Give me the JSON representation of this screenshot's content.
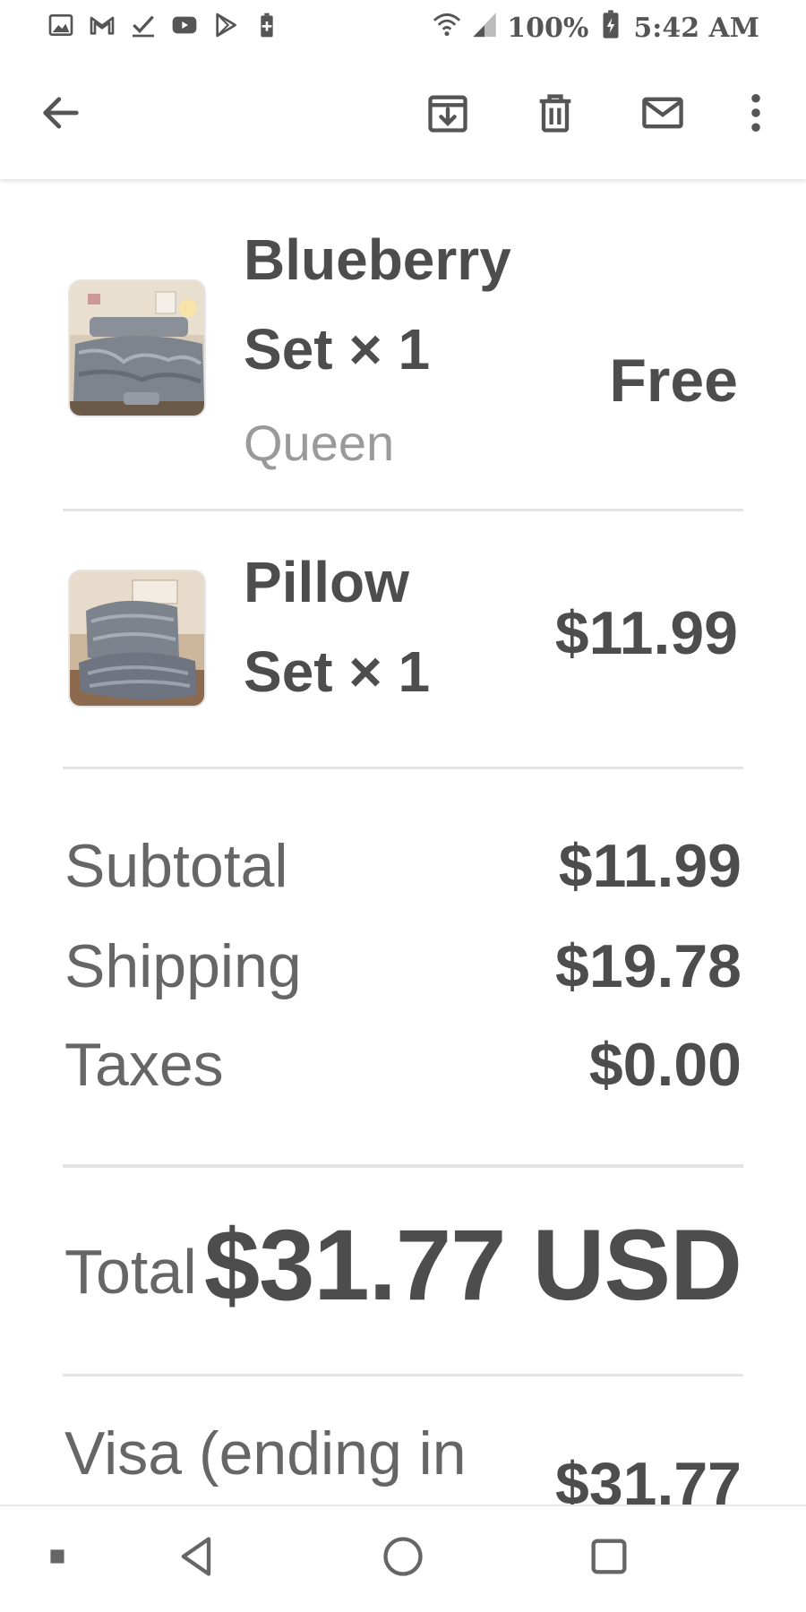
{
  "status_bar": {
    "left_icons": [
      "gallery-icon",
      "gmail-icon",
      "tasks-check-icon",
      "youtube-icon",
      "play-store-icon",
      "battery-saver-icon"
    ],
    "battery": "100%",
    "time": "5:42 AM"
  },
  "app_bar": {
    "icons": [
      "back-arrow-icon",
      "archive-icon",
      "delete-icon",
      "mark-unread-icon",
      "more-options-icon"
    ]
  },
  "order": {
    "items": [
      {
        "title_line1": "Blueberry",
        "title_line2": "Set × 1",
        "variant": "Queen",
        "price": "Free",
        "thumbnail": "bedding-set-thumbnail"
      },
      {
        "title_line1": "Pillow",
        "title_line2": "Set × 1",
        "variant": "",
        "price": "$11.99",
        "thumbnail": "pillow-set-thumbnail"
      }
    ],
    "summary": [
      {
        "label": "Subtotal",
        "value": "$11.99"
      },
      {
        "label": "Shipping",
        "value": "$19.78"
      },
      {
        "label": "Taxes",
        "value": "$0.00"
      }
    ],
    "total": {
      "label": "Total",
      "value": "$31.77 USD"
    },
    "payment": {
      "label": "Visa (ending in",
      "value": "$31.77"
    }
  },
  "nav_bar": {
    "icons": [
      "recent-dot-icon",
      "back-triangle-icon",
      "home-circle-icon",
      "overview-square-icon"
    ]
  },
  "colors": {
    "text_dark": "#4d4d4d",
    "text_muted": "#9a9a9a",
    "divider": "#e4e4e4"
  }
}
